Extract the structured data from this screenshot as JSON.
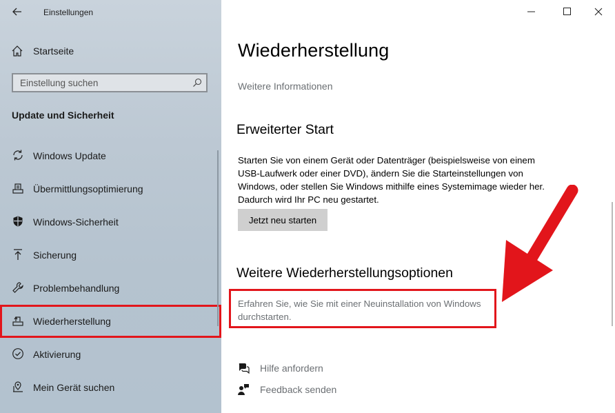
{
  "window": {
    "app_title": "Einstellungen",
    "back_icon": "arrow-left-icon",
    "controls": [
      "minimize-icon",
      "maximize-icon",
      "close-icon"
    ]
  },
  "sidebar": {
    "home_label": "Startseite",
    "search_placeholder": "Einstellung suchen",
    "section_title": "Update und Sicherheit",
    "items": [
      {
        "label": "Windows Update",
        "icon": "sync-icon"
      },
      {
        "label": "Übermittlungsoptimierung",
        "icon": "delivery-optimization-icon"
      },
      {
        "label": "Windows-Sicherheit",
        "icon": "shield-icon"
      },
      {
        "label": "Sicherung",
        "icon": "backup-arrow-icon"
      },
      {
        "label": "Problembehandlung",
        "icon": "wrench-icon"
      },
      {
        "label": "Wiederherstellung",
        "icon": "recovery-icon",
        "selected": true
      },
      {
        "label": "Aktivierung",
        "icon": "check-circle-icon"
      },
      {
        "label": "Mein Gerät suchen",
        "icon": "find-device-icon"
      }
    ]
  },
  "main": {
    "title": "Wiederherstellung",
    "more_info_link": "Weitere Informationen",
    "advanced_start": {
      "heading": "Erweiterter Start",
      "description": "Starten Sie von einem Gerät oder Datenträger (beispielsweise von einem USB-Laufwerk oder einer DVD), ändern Sie die Starteinstellungen von Windows, oder stellen Sie Windows mithilfe eines Systemimage wieder her. Dadurch wird Ihr PC neu gestartet.",
      "button_label": "Jetzt neu starten"
    },
    "more_options": {
      "heading": "Weitere Wiederherstellungsoptionen",
      "link": "Erfahren Sie, wie Sie mit einer Neuinstallation von Windows durchstarten."
    },
    "help": {
      "get_help": "Hilfe anfordern",
      "feedback": "Feedback senden"
    }
  },
  "colors": {
    "highlight": "#e2151b",
    "link_gray": "#6b6f73",
    "button_bg": "#cfcfcf"
  }
}
